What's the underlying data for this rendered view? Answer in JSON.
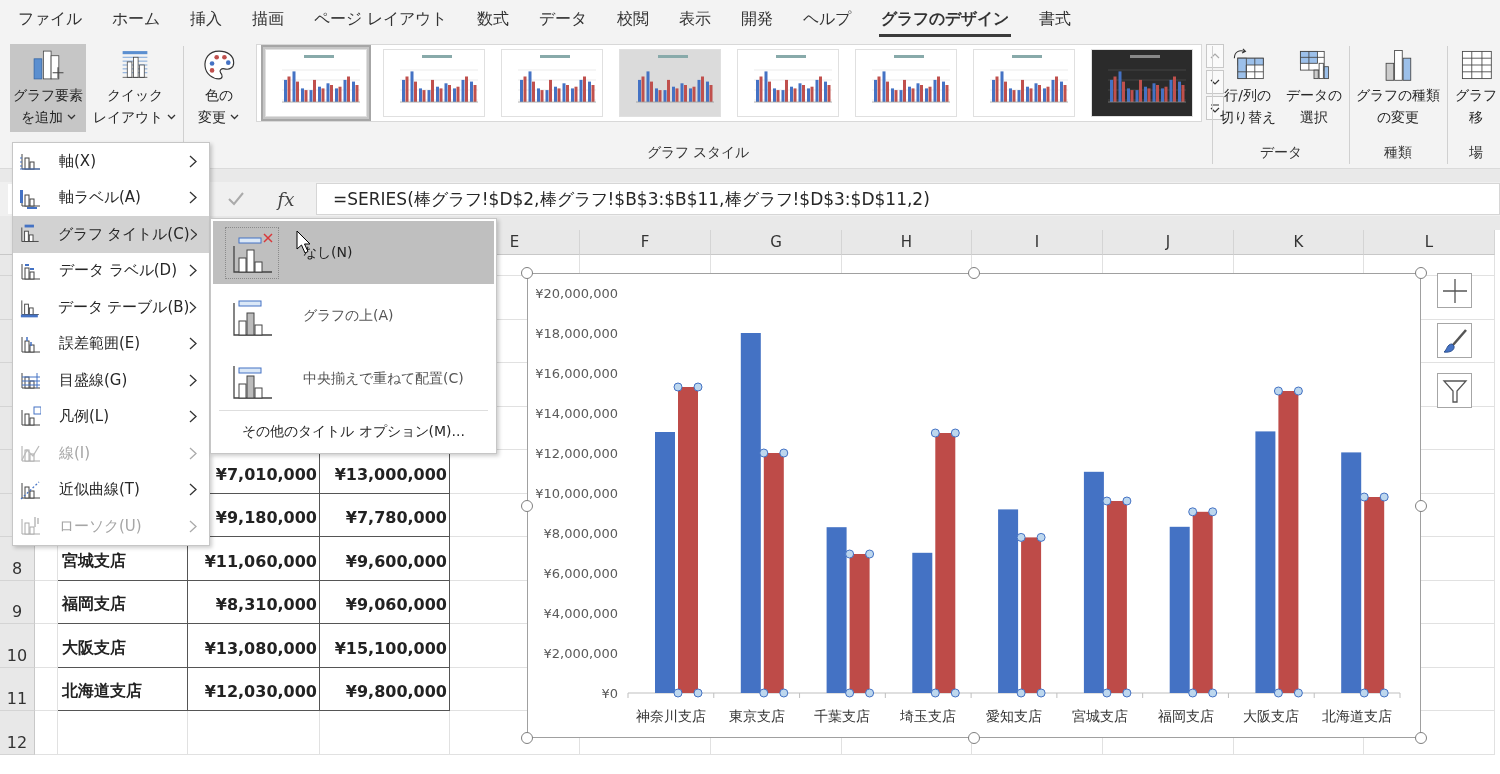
{
  "ribbon_tabs": [
    {
      "label": "ファイル",
      "selected": false
    },
    {
      "label": "ホーム",
      "selected": false
    },
    {
      "label": "挿入",
      "selected": false
    },
    {
      "label": "描画",
      "selected": false
    },
    {
      "label": "ページ レイアウト",
      "selected": false
    },
    {
      "label": "数式",
      "selected": false
    },
    {
      "label": "データ",
      "selected": false
    },
    {
      "label": "校閲",
      "selected": false
    },
    {
      "label": "表示",
      "selected": false
    },
    {
      "label": "開発",
      "selected": false
    },
    {
      "label": "ヘルプ",
      "selected": false
    },
    {
      "label": "グラフのデザイン",
      "selected": true
    },
    {
      "label": "書式",
      "selected": false
    }
  ],
  "ribbon": {
    "layout_buttons": [
      {
        "label_lines": [
          "グラフ要素",
          "を追加"
        ],
        "dropdown": true,
        "pressed": true
      },
      {
        "label_lines": [
          "クイック",
          "レイアウト"
        ],
        "dropdown": true,
        "pressed": false
      }
    ],
    "color_button": {
      "label_lines": [
        "色の",
        "変更"
      ],
      "dropdown": true
    },
    "chart_styles": [
      {
        "kind": "plain",
        "selected": true
      },
      {
        "kind": "plain",
        "selected": false
      },
      {
        "kind": "plain",
        "selected": false
      },
      {
        "kind": "shaded",
        "selected": false
      },
      {
        "kind": "plain",
        "selected": false
      },
      {
        "kind": "plain",
        "selected": false
      },
      {
        "kind": "plain",
        "selected": false
      },
      {
        "kind": "dark",
        "selected": false
      }
    ],
    "chart_styles_label": "グラフ スタイル",
    "groups": [
      {
        "label": "データ",
        "buttons": [
          {
            "label_lines": [
              "行/列の",
              "切り替え"
            ]
          },
          {
            "label_lines": [
              "データの",
              "選択"
            ]
          }
        ]
      },
      {
        "label": "種類",
        "buttons": [
          {
            "label_lines": [
              "グラフの種類",
              "の変更"
            ]
          }
        ]
      },
      {
        "label": "場",
        "buttons": [
          {
            "label_lines": [
              "グラフ",
              "移"
            ]
          }
        ]
      }
    ]
  },
  "formula_bar": {
    "function_button": "fx",
    "formula": "=SERIES(棒グラフ!$D$2,棒グラフ!$B$3:$B$11,棒グラフ!$D$3:$D$11,2)"
  },
  "sheet": {
    "column_headers": [
      "E",
      "F",
      "G",
      "H",
      "I",
      "J",
      "K",
      "L"
    ],
    "row_headers": [
      "8",
      "9",
      "10",
      "11",
      "12"
    ],
    "table_rows": [
      {
        "column_c": "¥7,010,000",
        "column_d": "¥13,000,000"
      },
      {
        "column_c": "¥9,180,000",
        "column_d": "¥7,780,000"
      },
      {
        "branch": "宮城支店",
        "column_c": "¥11,060,000",
        "column_d": "¥9,600,000"
      },
      {
        "branch": "福岡支店",
        "column_c": "¥8,310,000",
        "column_d": "¥9,060,000"
      },
      {
        "branch": "大阪支店",
        "column_c": "¥13,080,000",
        "column_d": "¥15,100,000"
      },
      {
        "branch": "北海道支店",
        "column_c": "¥12,030,000",
        "column_d": "¥9,800,000"
      }
    ]
  },
  "chart": {
    "chart_data": {
      "type": "bar",
      "categories": [
        "神奈川支店",
        "東京支店",
        "千葉支店",
        "埼玉支店",
        "愛知支店",
        "宮城支店",
        "福岡支店",
        "大阪支店",
        "北海道支店"
      ],
      "series": [
        {
          "color": "#4472c4",
          "values": [
            13050000,
            18000000,
            8290000,
            7010000,
            9180000,
            11060000,
            8310000,
            13080000,
            12030000
          ]
        },
        {
          "color": "#be4b48",
          "values": [
            15300000,
            12000000,
            6950000,
            13000000,
            7780000,
            9600000,
            9060000,
            15100000,
            9800000
          ]
        }
      ],
      "ylim": [
        0,
        20000000
      ],
      "yticks": [
        {
          "value": 0,
          "label": "¥0"
        },
        {
          "value": 2000000,
          "label": "¥2,000,000"
        },
        {
          "value": 4000000,
          "label": "¥4,000,000"
        },
        {
          "value": 6000000,
          "label": "¥6,000,000"
        },
        {
          "value": 8000000,
          "label": "¥8,000,000"
        },
        {
          "value": 10000000,
          "label": "¥10,000,000"
        },
        {
          "value": 12000000,
          "label": "¥12,000,000"
        },
        {
          "value": 14000000,
          "label": "¥14,000,000"
        },
        {
          "value": 16000000,
          "label": "¥16,000,000"
        },
        {
          "value": 18000000,
          "label": "¥18,000,000"
        },
        {
          "value": 20000000,
          "label": "¥20,000,000"
        }
      ]
    },
    "series_selected": [
      false,
      true
    ]
  },
  "menu": {
    "items": [
      {
        "label": "軸(X)",
        "selected": false,
        "disabled": false
      },
      {
        "label": "軸ラベル(A)",
        "selected": false,
        "disabled": false
      },
      {
        "label": "グラフ タイトル(C)",
        "selected": true,
        "disabled": false
      },
      {
        "label": "データ ラベル(D)",
        "selected": false,
        "disabled": false
      },
      {
        "label": "データ テーブル(B)",
        "selected": false,
        "disabled": false
      },
      {
        "label": "誤差範囲(E)",
        "selected": false,
        "disabled": false
      },
      {
        "label": "目盛線(G)",
        "selected": false,
        "disabled": false
      },
      {
        "label": "凡例(L)",
        "selected": false,
        "disabled": false
      },
      {
        "label": "線(I)",
        "selected": false,
        "disabled": true
      },
      {
        "label": "近似曲線(T)",
        "selected": false,
        "disabled": false
      },
      {
        "label": "ローソク(U)",
        "selected": false,
        "disabled": true
      }
    ]
  },
  "submenu": {
    "items": [
      {
        "label": "なし(N)",
        "selected": true
      },
      {
        "label": "グラフの上(A)",
        "selected": false
      },
      {
        "label": "中央揃えで重ねて配置(C)",
        "selected": false
      }
    ],
    "more_options": "その他のタイトル オプション(M)..."
  }
}
